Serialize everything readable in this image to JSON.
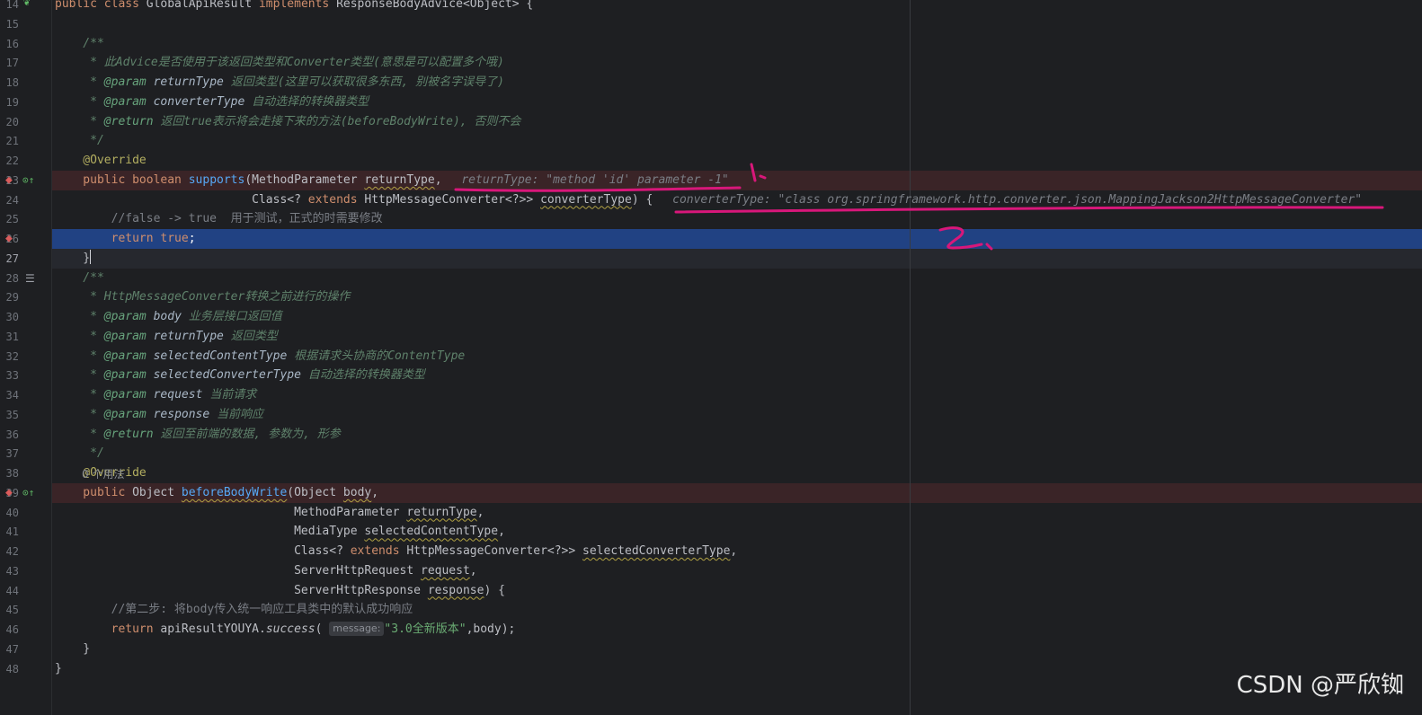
{
  "lines": [
    {
      "n": "14",
      "t": [
        [
          "kw",
          "public class "
        ],
        [
          "ty",
          "GlobalApiResult "
        ],
        [
          "kw",
          "implements "
        ],
        [
          "ty",
          "ResponseBodyAdvice<Object> {"
        ]
      ]
    },
    {
      "n": "15",
      "t": []
    },
    {
      "n": "16",
      "t": [
        [
          "doc",
          "    /**"
        ]
      ]
    },
    {
      "n": "17",
      "t": [
        [
          "doc",
          "     * 此Advice是否使用于该返回类型和Converter类型(意思是可以配置多个哦)"
        ]
      ]
    },
    {
      "n": "18",
      "t": [
        [
          "doc",
          "     * "
        ],
        [
          "tag",
          "@param "
        ],
        [
          "dp",
          "returnType "
        ],
        [
          "doc",
          "返回类型(这里可以获取很多东西, 别被名字误导了)"
        ]
      ]
    },
    {
      "n": "19",
      "t": [
        [
          "doc",
          "     * "
        ],
        [
          "tag",
          "@param "
        ],
        [
          "dp",
          "converterType "
        ],
        [
          "doc",
          "自动选择的转换器类型"
        ]
      ]
    },
    {
      "n": "20",
      "t": [
        [
          "doc",
          "     * "
        ],
        [
          "tag",
          "@return "
        ],
        [
          "doc",
          "返回true表示将会走接下来的方法(beforeBodyWrite), 否则不会"
        ]
      ]
    },
    {
      "n": "21",
      "t": [
        [
          "doc",
          "     */"
        ]
      ]
    },
    {
      "n": "22",
      "t": [
        [
          "an",
          "    @Override"
        ]
      ]
    },
    {
      "n": "23",
      "t": [
        [
          "kw",
          "    public boolean "
        ],
        [
          "fn",
          "supports"
        ],
        [
          "ty",
          "(MethodParameter "
        ],
        [
          "wv",
          "returnType"
        ],
        [
          "ty",
          ", "
        ],
        [
          "hint",
          "returnType: \"method 'id' parameter -1\""
        ]
      ]
    },
    {
      "n": "24",
      "t": [
        [
          "ty",
          "                            Class<? "
        ],
        [
          "kw",
          "extends "
        ],
        [
          "ty",
          "HttpMessageConverter<?>> "
        ],
        [
          "wv",
          "converterType"
        ],
        [
          "ty",
          ") { "
        ],
        [
          "hint",
          "converterType: \"class org.springframework.http.converter.json.MappingJackson2HttpMessageConverter\""
        ]
      ]
    },
    {
      "n": "25",
      "t": [
        [
          "cm",
          "        //false -> true  用于测试，正式的时需要修改"
        ]
      ]
    },
    {
      "n": "26",
      "t": [
        [
          "kw",
          "        return true"
        ],
        [
          "ty",
          ";"
        ]
      ]
    },
    {
      "n": "27",
      "t": [
        [
          "ty",
          "    }"
        ]
      ]
    },
    {
      "n": "28",
      "t": [
        [
          "doc",
          "    /**"
        ]
      ]
    },
    {
      "n": "29",
      "t": [
        [
          "doc",
          "     * HttpMessageConverter转换之前进行的操作"
        ]
      ]
    },
    {
      "n": "30",
      "t": [
        [
          "doc",
          "     * "
        ],
        [
          "tag",
          "@param "
        ],
        [
          "dp",
          "body "
        ],
        [
          "doc",
          "业务层接口返回值"
        ]
      ]
    },
    {
      "n": "31",
      "t": [
        [
          "doc",
          "     * "
        ],
        [
          "tag",
          "@param "
        ],
        [
          "dp",
          "returnType "
        ],
        [
          "doc",
          "返回类型"
        ]
      ]
    },
    {
      "n": "32",
      "t": [
        [
          "doc",
          "     * "
        ],
        [
          "tag",
          "@param "
        ],
        [
          "dp",
          "selectedContentType "
        ],
        [
          "doc",
          "根据请求头协商的ContentType"
        ]
      ]
    },
    {
      "n": "33",
      "t": [
        [
          "doc",
          "     * "
        ],
        [
          "tag",
          "@param "
        ],
        [
          "dp",
          "selectedConverterType "
        ],
        [
          "doc",
          "自动选择的转换器类型"
        ]
      ]
    },
    {
      "n": "34",
      "t": [
        [
          "doc",
          "     * "
        ],
        [
          "tag",
          "@param "
        ],
        [
          "dp",
          "request "
        ],
        [
          "doc",
          "当前请求"
        ]
      ]
    },
    {
      "n": "35",
      "t": [
        [
          "doc",
          "     * "
        ],
        [
          "tag",
          "@param "
        ],
        [
          "dp",
          "response "
        ],
        [
          "doc",
          "当前响应"
        ]
      ]
    },
    {
      "n": "36",
      "t": [
        [
          "doc",
          "     * "
        ],
        [
          "tag",
          "@return "
        ],
        [
          "doc",
          "返回至前端的数据, 参数为, 形参"
        ]
      ]
    },
    {
      "n": "37",
      "t": [
        [
          "doc",
          "     */"
        ]
      ]
    },
    {
      "n": "38",
      "t": [
        [
          "an",
          "    @Override"
        ]
      ]
    },
    {
      "n": "39",
      "t": [
        [
          "kw",
          "    public "
        ],
        [
          "ty",
          "Object "
        ],
        [
          "fnu",
          "beforeBodyWrite"
        ],
        [
          "ty",
          "(Object "
        ],
        [
          "wv",
          "body"
        ],
        [
          "ty",
          ","
        ]
      ]
    },
    {
      "n": "40",
      "t": [
        [
          "ty",
          "                                  MethodParameter "
        ],
        [
          "wv",
          "returnType"
        ],
        [
          "ty",
          ","
        ]
      ]
    },
    {
      "n": "41",
      "t": [
        [
          "ty",
          "                                  MediaType "
        ],
        [
          "wv",
          "selectedContentType"
        ],
        [
          "ty",
          ","
        ]
      ]
    },
    {
      "n": "42",
      "t": [
        [
          "ty",
          "                                  Class<? "
        ],
        [
          "kw",
          "extends "
        ],
        [
          "ty",
          "HttpMessageConverter<?>> "
        ],
        [
          "wv",
          "selectedConverterType"
        ],
        [
          "ty",
          ","
        ]
      ]
    },
    {
      "n": "43",
      "t": [
        [
          "ty",
          "                                  ServerHttpRequest "
        ],
        [
          "wv",
          "request"
        ],
        [
          "ty",
          ","
        ]
      ]
    },
    {
      "n": "44",
      "t": [
        [
          "ty",
          "                                  ServerHttpResponse "
        ],
        [
          "wv",
          "response"
        ],
        [
          "ty",
          ") {"
        ]
      ]
    },
    {
      "n": "45",
      "t": [
        [
          "cm",
          "        //第二步: 将body传入统一响应工具类中的默认成功响应"
        ]
      ]
    },
    {
      "n": "46",
      "t": [
        [
          "kw",
          "        return "
        ],
        [
          "ty",
          "apiResultYOUYA."
        ],
        [
          "st",
          "success"
        ],
        [
          "ty",
          "( "
        ],
        [
          "inlay",
          "message:"
        ],
        [
          "str",
          "\"3.0全新版本\""
        ],
        [
          "ty",
          ",body);"
        ]
      ]
    },
    {
      "n": "47",
      "t": [
        [
          "ty",
          "    }"
        ]
      ]
    },
    {
      "n": "48",
      "t": [
        [
          "ty",
          "}"
        ]
      ]
    }
  ],
  "usage_hint": "0 个用法",
  "annotation_marks": {
    "mark1": "1、",
    "mark2": "2、"
  },
  "watermark": "CSDN @严欣铷",
  "colors": {
    "background": "#1e1f22",
    "breakpoint_line": "#3a2427",
    "execution_line": "#214283",
    "annotation_pen": "#d8177a"
  }
}
